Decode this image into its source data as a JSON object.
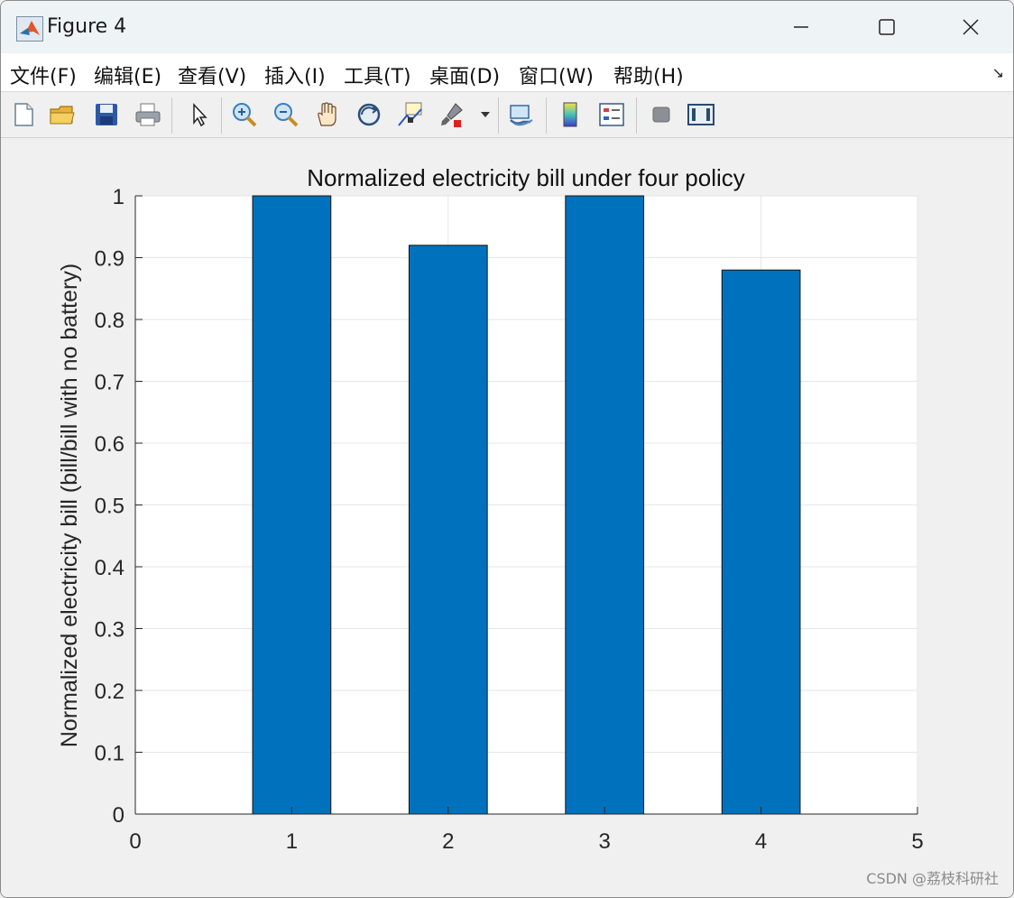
{
  "window": {
    "title": "Figure 4"
  },
  "menubar": {
    "items": [
      {
        "label": "文件(F)"
      },
      {
        "label": "编辑(E)"
      },
      {
        "label": "查看(V)"
      },
      {
        "label": "插入(I)"
      },
      {
        "label": "工具(T)"
      },
      {
        "label": "桌面(D)"
      },
      {
        "label": "窗口(W)"
      },
      {
        "label": "帮助(H)"
      }
    ],
    "dock_arrow": "↘"
  },
  "toolbar": {
    "buttons": [
      {
        "name": "new-figure-icon"
      },
      {
        "name": "open-file-icon"
      },
      {
        "name": "save-icon"
      },
      {
        "name": "print-icon"
      },
      {
        "name": "select-pointer-icon"
      },
      {
        "name": "zoom-in-icon"
      },
      {
        "name": "zoom-out-icon"
      },
      {
        "name": "pan-hand-icon"
      },
      {
        "name": "rotate-3d-icon"
      },
      {
        "name": "data-cursor-icon"
      },
      {
        "name": "brush-icon"
      },
      {
        "name": "link-plot-icon"
      },
      {
        "name": "colorbar-icon"
      },
      {
        "name": "legend-icon"
      },
      {
        "name": "hide-plot-tools-icon"
      },
      {
        "name": "show-plot-tools-icon"
      }
    ]
  },
  "colors": {
    "bar_fill": "#0072bd",
    "grid": "#e6e6e6",
    "axes": "#262626"
  },
  "chart_data": {
    "type": "bar",
    "title": "Normalized electricity bill under four policy",
    "xlabel": "",
    "ylabel": "Normalized electricity bill (bill/bill with no battery)",
    "categories": [
      1,
      2,
      3,
      4
    ],
    "values": [
      1.0,
      0.92,
      1.0,
      0.88
    ],
    "xlim": [
      0,
      5
    ],
    "ylim": [
      0,
      1
    ],
    "xticks": [
      "0",
      "1",
      "2",
      "3",
      "4",
      "5"
    ],
    "yticks": [
      "0",
      "0.1",
      "0.2",
      "0.3",
      "0.4",
      "0.5",
      "0.6",
      "0.7",
      "0.8",
      "0.9",
      "1"
    ],
    "grid": true,
    "legend": "none"
  },
  "watermark": "CSDN @荔枝科研社"
}
